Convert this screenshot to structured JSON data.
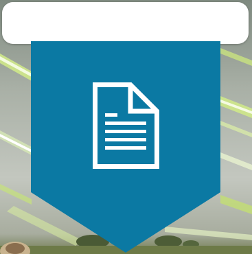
{
  "top_bar": {
    "text": ""
  },
  "tile": {
    "icon": "document-icon",
    "color": "#0b79a3"
  },
  "background": {
    "description_colors": [
      "#8f9a8a",
      "#b8bdb4",
      "#6d7a55"
    ]
  }
}
